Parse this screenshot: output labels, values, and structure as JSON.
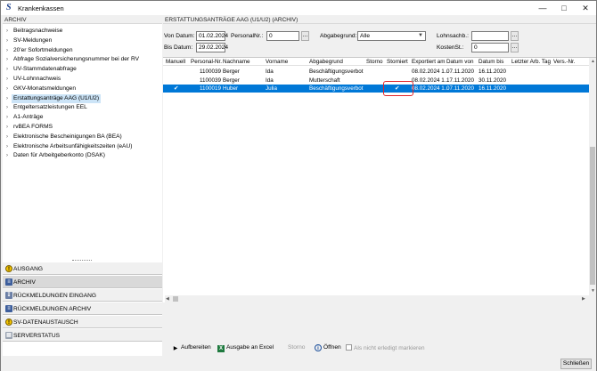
{
  "window": {
    "title": "Krankenkassen",
    "app_icon": "S"
  },
  "left": {
    "header": "ARCHIV",
    "tree": [
      {
        "label": "Beitragsnachweise"
      },
      {
        "label": "SV-Meldungen"
      },
      {
        "label": "20'er Sofortmeldungen"
      },
      {
        "label": "Abfrage Sozialversicherungsnummer bei der RV"
      },
      {
        "label": "UV-Stammdatenabfrage"
      },
      {
        "label": "UV-Lohnnachweis"
      },
      {
        "label": "GKV-Monatsmeldungen"
      },
      {
        "label": "Erstattungsanträge AAG (U1/U2)"
      },
      {
        "label": "Entgeltersatzleistungen EEL"
      },
      {
        "label": "A1-Anträge"
      },
      {
        "label": "rvBEA FORMS"
      },
      {
        "label": "Elektronische Bescheinigungen BA (BEA)"
      },
      {
        "label": "Elektronische Arbeitsunfähigkeitszeiten (eAU)"
      },
      {
        "label": "Daten für Arbeitgeberkonto (DSAK)"
      }
    ],
    "selected_index": 7,
    "nav": [
      {
        "label": "AUSGANG",
        "icon": "warning-icon"
      },
      {
        "label": "ARCHIV",
        "icon": "archive-icon"
      },
      {
        "label": "RÜCKMELDUNGEN EINGANG",
        "icon": "inbox-icon"
      },
      {
        "label": "RÜCKMELDUNGEN ARCHIV",
        "icon": "archive-icon"
      },
      {
        "label": "SV-DATENAUSTAUSCH",
        "icon": "warning-icon"
      },
      {
        "label": "SERVERSTATUS",
        "icon": "server-icon"
      }
    ],
    "nav_active_index": 1
  },
  "right": {
    "header": "ERSTATTUNGSANTRÄGE AAG (U1/U2) (ARCHIV)",
    "filters": {
      "von_datum_label": "Von Datum:",
      "von_datum": "01.02.2024",
      "bis_datum_label": "Bis Datum:",
      "bis_datum": "29.02.2024",
      "personalnr_label": "PersonalNr.:",
      "personalnr": "0",
      "abgabegrund_label": "Abgabegrund:",
      "abgabegrund": "Alle",
      "lohnsachb_label": "Lohnsachb.:",
      "lohnsachb": "",
      "kostenst_label": "KostenSt.:",
      "kostenst": "0"
    },
    "columns": [
      "Manuell",
      "Personal-Nr.",
      "Nachname",
      "Vorname",
      "Abgabegrund",
      "Storno",
      "Storniert",
      "Exportiert am",
      "Datum von",
      "Datum bis",
      "Letzter Arb. Tag",
      "Vers.-Nr."
    ],
    "rows": [
      {
        "manuell": "",
        "personalnr": "1100039",
        "nachname": "Berger",
        "vorname": "Ida",
        "abgabegrund": "Beschäftigungsverbot",
        "storno": "",
        "storniert": "",
        "exportiert": "08.02.2024 1...",
        "von": "07.11.2020",
        "bis": "16.11.2020",
        "letzter": "",
        "versnr": ""
      },
      {
        "manuell": "",
        "personalnr": "1100039",
        "nachname": "Berger",
        "vorname": "Ida",
        "abgabegrund": "Mutterschaft",
        "storno": "",
        "storniert": "",
        "exportiert": "08.02.2024 1...",
        "von": "17.11.2020",
        "bis": "30.11.2020",
        "letzter": "",
        "versnr": ""
      },
      {
        "manuell": "✔",
        "personalnr": "1100019",
        "nachname": "Huber",
        "vorname": "Julia",
        "abgabegrund": "Beschäftigungsverbot",
        "storno": "",
        "storniert": "✔",
        "exportiert": "08.02.2024 1...",
        "von": "07.11.2020",
        "bis": "16.11.2020",
        "letzter": "",
        "versnr": ""
      }
    ],
    "selected_row": 2
  },
  "toolbar": {
    "aufbereiten": "Aufbereiten",
    "ausgabe_excel": "Ausgabe an Excel",
    "storno": "Storno",
    "oeffnen": "Öffnen",
    "nicht_erledigt": "Als nicht erledigt markieren"
  },
  "footer": {
    "close": "Schließen"
  }
}
